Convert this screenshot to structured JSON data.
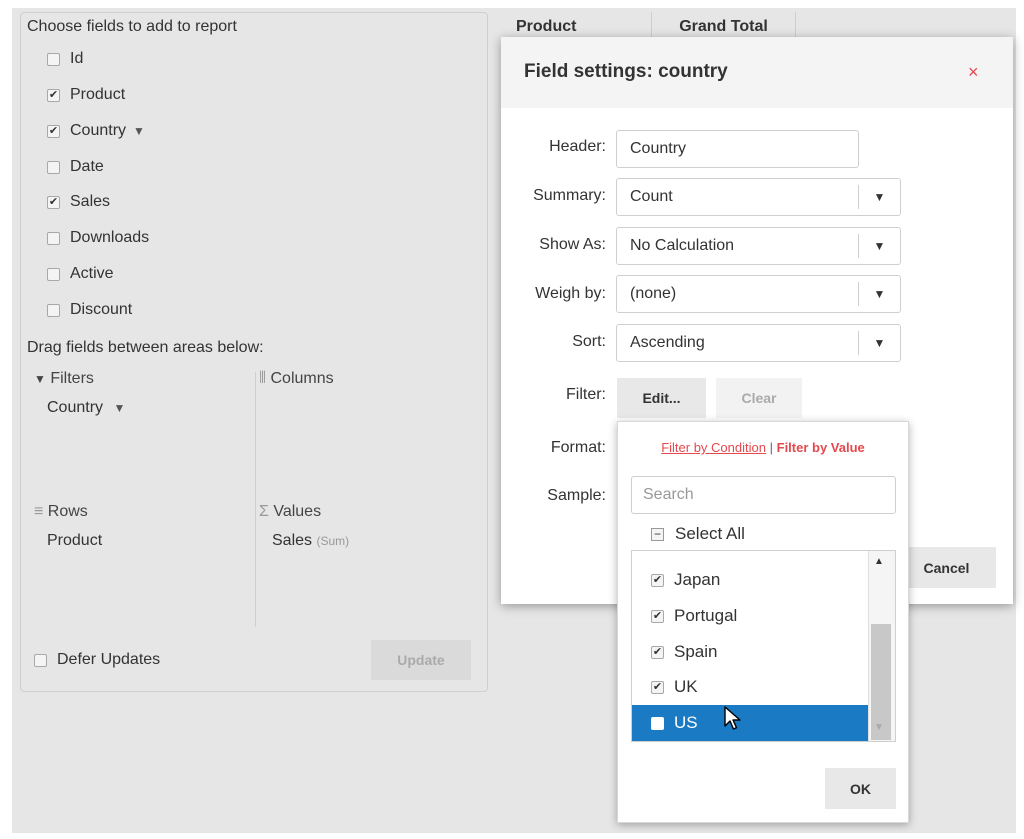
{
  "fields_panel": {
    "title": "Choose fields to add to report",
    "fields": [
      {
        "label": "Id",
        "checked": false,
        "filtered": false
      },
      {
        "label": "Product",
        "checked": true,
        "filtered": false
      },
      {
        "label": "Country",
        "checked": true,
        "filtered": true
      },
      {
        "label": "Date",
        "checked": false,
        "filtered": false
      },
      {
        "label": "Sales",
        "checked": true,
        "filtered": false
      },
      {
        "label": "Downloads",
        "checked": false,
        "filtered": false
      },
      {
        "label": "Active",
        "checked": false,
        "filtered": false
      },
      {
        "label": "Discount",
        "checked": false,
        "filtered": false
      }
    ],
    "drag_label": "Drag fields between areas below:",
    "areas": {
      "filters": {
        "label": "Filters",
        "items": [
          "Country"
        ]
      },
      "columns": {
        "label": "Columns",
        "items": []
      },
      "rows": {
        "label": "Rows",
        "items": [
          "Product"
        ]
      },
      "values": {
        "label": "Values",
        "items": [
          {
            "name": "Sales",
            "summary": "(Sum)"
          }
        ]
      }
    },
    "defer_updates_label": "Defer Updates",
    "update_label": "Update"
  },
  "grid": {
    "headers": [
      "Product",
      "Grand Total"
    ]
  },
  "dialog": {
    "title": "Field settings: country",
    "close_glyph": "×",
    "header_label": "Header:",
    "header_value": "Country",
    "summary_label": "Summary:",
    "summary_value": "Count",
    "show_as_label": "Show As:",
    "show_as_value": "No Calculation",
    "weigh_by_label": "Weigh by:",
    "weigh_by_value": "(none)",
    "sort_label": "Sort:",
    "sort_value": "Ascending",
    "filter_label": "Filter:",
    "edit_label": "Edit...",
    "clear_label": "Clear",
    "format_label": "Format:",
    "sample_label": "Sample:",
    "cancel_label": "Cancel"
  },
  "filter_popup": {
    "by_condition": "Filter by Condition",
    "separator": "|",
    "by_value": "Filter by Value",
    "search_placeholder": "Search",
    "select_all": "Select All",
    "items": [
      {
        "label": "Japan",
        "checked": true,
        "selected": false
      },
      {
        "label": "Portugal",
        "checked": true,
        "selected": false
      },
      {
        "label": "Spain",
        "checked": true,
        "selected": false
      },
      {
        "label": "UK",
        "checked": true,
        "selected": false
      },
      {
        "label": "US",
        "checked": false,
        "selected": true
      }
    ],
    "ok_label": "OK"
  },
  "icons": {
    "checkmark": "✔",
    "funnel": "▼",
    "dropdown": "▼",
    "columns": "⦀",
    "rows": "≡",
    "values": "Σ",
    "minus": "−",
    "scroll_up": "▲",
    "scroll_down": "▼"
  },
  "colors": {
    "accent": "#e5484d",
    "selection": "#1a7ac4",
    "overlay": "#e6e6e6"
  }
}
